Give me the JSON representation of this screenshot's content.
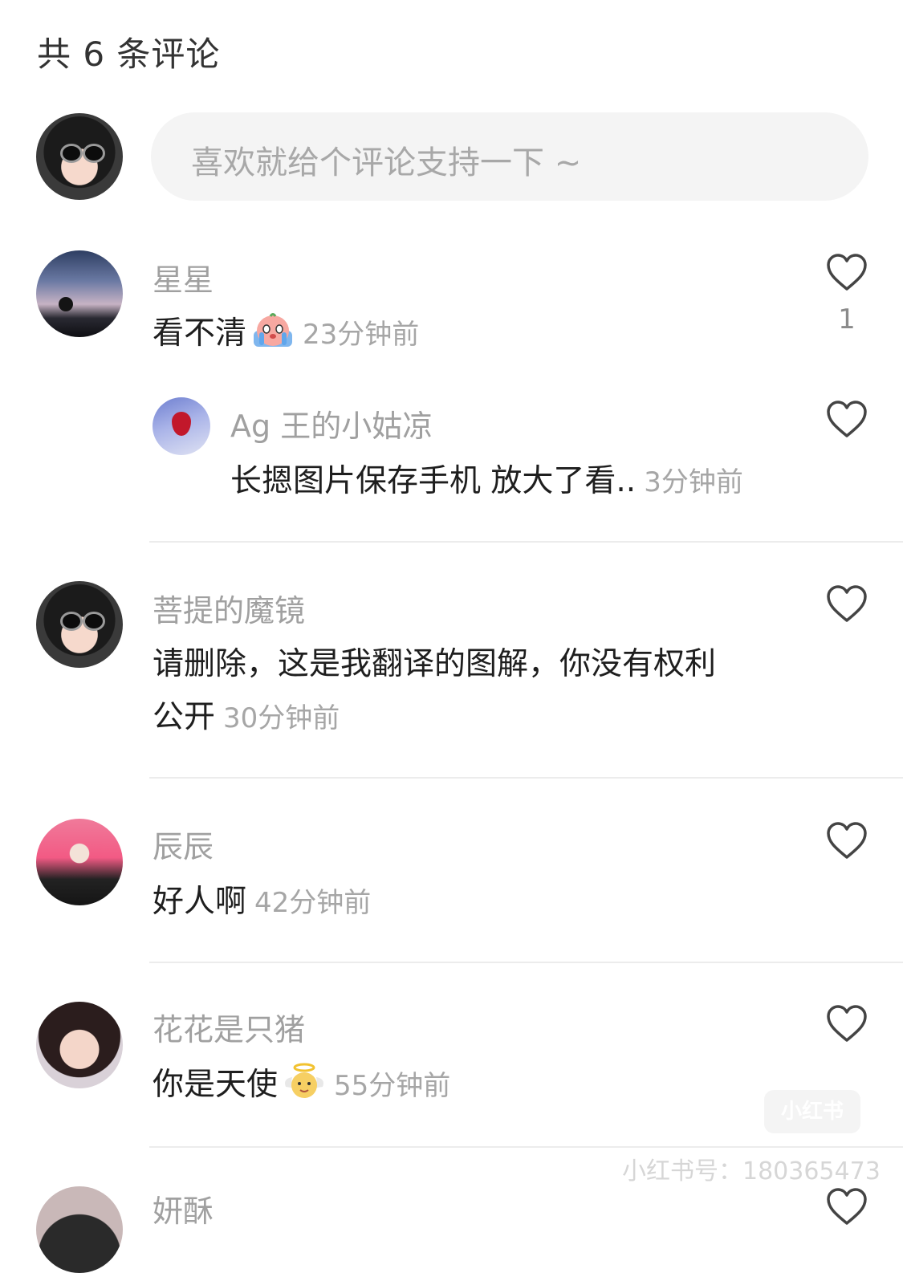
{
  "header": {
    "title": "共 6 条评论"
  },
  "composer": {
    "placeholder": "喜欢就给个评论支持一下 ~"
  },
  "comments": [
    {
      "name": "星星",
      "text": "看不清",
      "emoji": "crying-face-emoji",
      "time": "23分钟前",
      "likes": "1",
      "replies": [
        {
          "name": "Ag 王的小姑凉",
          "text": "长摁图片保存手机 放大了看..",
          "time": "3分钟前"
        }
      ]
    },
    {
      "name": "菩提的魔镜",
      "text_line1": "请删除，这是我翻译的图解，你没有权利",
      "text_line2": "公开",
      "time": "30分钟前"
    },
    {
      "name": "辰辰",
      "text": "好人啊",
      "time": "42分钟前"
    },
    {
      "name": "花花是只猪",
      "text": "你是天使",
      "emoji": "baby-angel-emoji",
      "time": "55分钟前"
    },
    {
      "name": "妍酥"
    }
  ],
  "watermark": {
    "logo": "小红书",
    "text": "小红书号：180365473"
  },
  "colors": {
    "name": "#a0a0a0",
    "text": "#1e1e1e",
    "time": "#a6a6a6",
    "divider": "#ececec",
    "input_bg": "#f4f4f4"
  }
}
